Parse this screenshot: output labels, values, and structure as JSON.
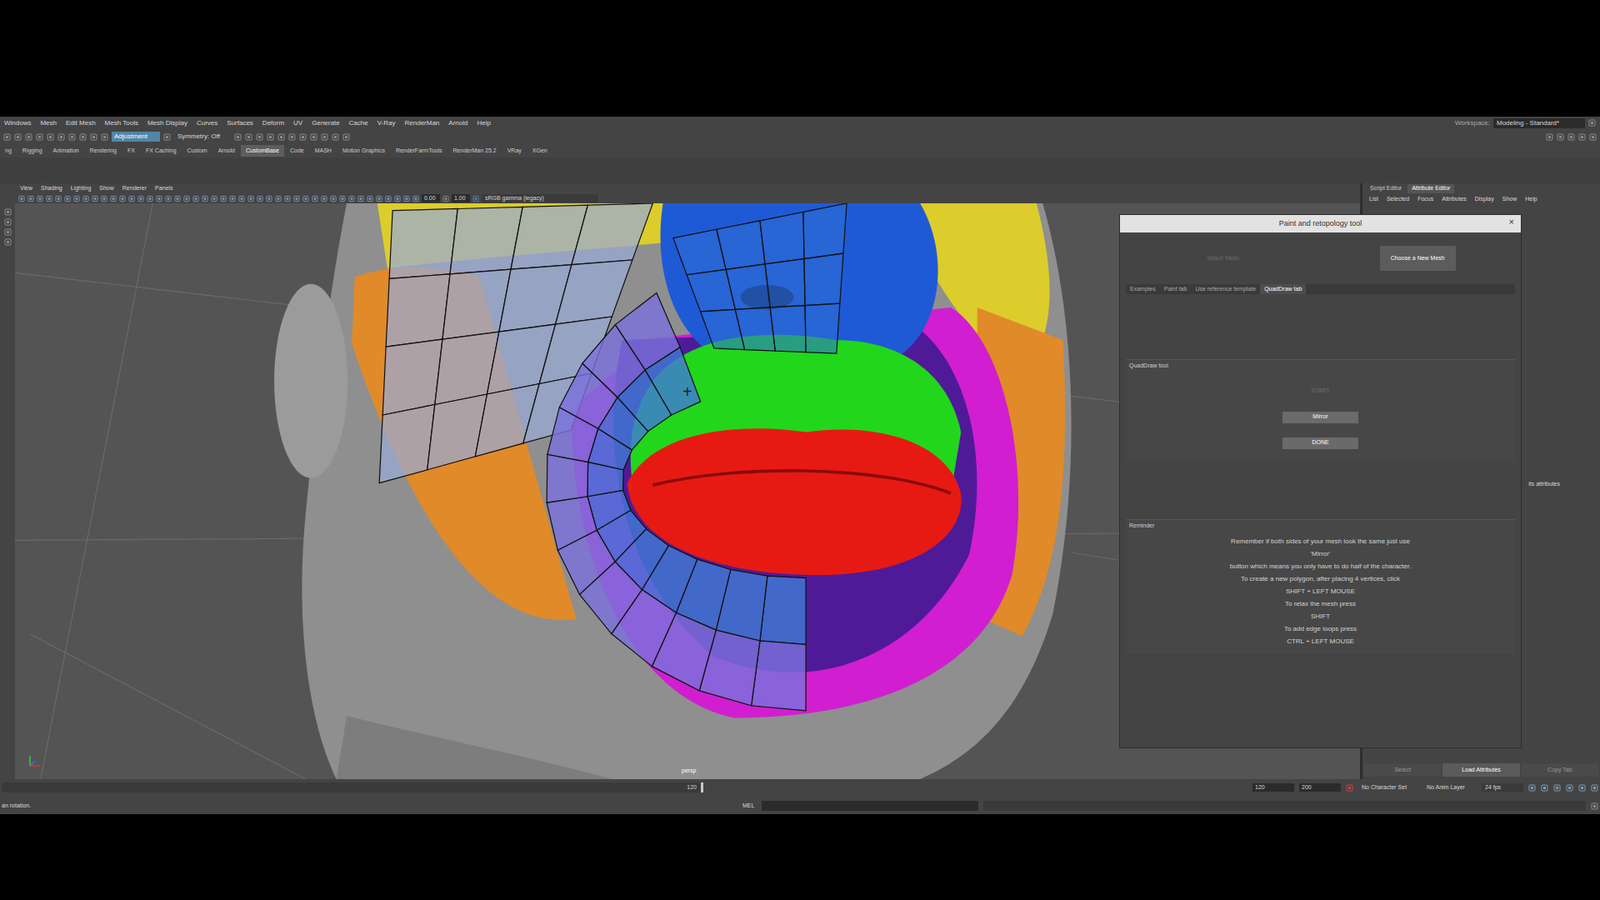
{
  "menu_bar": {
    "items": [
      "Windows",
      "Mesh",
      "Edit Mesh",
      "Mesh Tools",
      "Mesh Display",
      "Curves",
      "Surfaces",
      "Deform",
      "UV",
      "Generate",
      "Cache",
      "V-Ray",
      "RenderMan",
      "Arnold",
      "Help"
    ],
    "workspace_label": "Workspace:",
    "workspace": "Modeling - Standard*"
  },
  "status_line": {
    "mask_field": "Adjustment",
    "symmetry": "Symmetry: Off"
  },
  "shelf_tabs": [
    {
      "label": "ng",
      "selected": false
    },
    {
      "label": "Rigging",
      "selected": false
    },
    {
      "label": "Animation",
      "selected": false
    },
    {
      "label": "Rendering",
      "selected": false
    },
    {
      "label": "FX",
      "selected": false
    },
    {
      "label": "FX Caching",
      "selected": false
    },
    {
      "label": "Custom",
      "selected": false
    },
    {
      "label": "Arnold",
      "selected": false
    },
    {
      "label": "CustomBase",
      "selected": true
    },
    {
      "label": "Code",
      "selected": false
    },
    {
      "label": "MASH",
      "selected": false
    },
    {
      "label": "Motion Graphics",
      "selected": false
    },
    {
      "label": "RenderFarmTools",
      "selected": false
    },
    {
      "label": "RenderMan 25.2",
      "selected": false
    },
    {
      "label": "VRay",
      "selected": false
    },
    {
      "label": "XGen",
      "selected": false
    }
  ],
  "viewport": {
    "menu": [
      "View",
      "Shading",
      "Lighting",
      "Show",
      "Renderer",
      "Panels"
    ],
    "exposure": "0.00",
    "gamma": "1.00",
    "color_space": "sRGB gamma (legacy)",
    "camera": "persp",
    "cursor": "+",
    "paint_regions": [
      {
        "color": "#dccd2c"
      },
      {
        "color": "#e08a2a"
      },
      {
        "color": "#d11ed0"
      },
      {
        "color": "#4f1a98"
      },
      {
        "color": "#1f5ad6"
      },
      {
        "color": "#22d61c"
      },
      {
        "color": "#e61a12"
      }
    ]
  },
  "dialog": {
    "title": "Paint and retopology tool",
    "close": "×",
    "select_mesh": {
      "label": "Select Mesh",
      "disabled": true
    },
    "choose_mesh": {
      "label": "Choose a New Mesh",
      "disabled": false
    },
    "tabs": [
      {
        "label": "Examples",
        "selected": false
      },
      {
        "label": "Paint tab",
        "selected": false
      },
      {
        "label": "Use reference template",
        "selected": false
      },
      {
        "label": "QuadDraw tab",
        "selected": true
      }
    ],
    "quaddraw": {
      "title": "QuadDraw tool",
      "buttons": [
        {
          "label": "START",
          "disabled": true
        },
        {
          "label": "Mirror",
          "disabled": false
        },
        {
          "label": "DONE",
          "disabled": false
        }
      ]
    },
    "reminder": {
      "title": "Reminder",
      "lines": [
        "Remember if both sides of your mesh look the same just use",
        "'Mirror'",
        "button which means you only have to do half of the character.",
        "To create a new polygon, after placing 4 vertices, click",
        "SHIFT + LEFT MOUSE",
        "To relax the mesh press",
        "SHIFT",
        "To add edge loops press",
        "CTRL + LEFT MOUSE"
      ]
    }
  },
  "right_panel": {
    "tabs": [
      {
        "label": "Script Editor",
        "selected": false
      },
      {
        "label": "Attribute Editor",
        "selected": true
      }
    ],
    "menu": [
      "List",
      "Selected",
      "Focus",
      "Attributes",
      "Display",
      "Show",
      "Help"
    ],
    "message": "its attributes",
    "buttons": [
      {
        "label": "Select",
        "selected": false
      },
      {
        "label": "Load Attributes",
        "selected": true
      },
      {
        "label": "Copy Tab",
        "selected": false
      }
    ]
  },
  "time_slider": {
    "current": "120",
    "level": 1.0,
    "range_start": "120",
    "range_end": "200",
    "character_set": "No Character Set",
    "anim_layer": "No Anim Layer",
    "fps": "24 fps"
  },
  "command_line": {
    "language": "MEL",
    "help_line": "an rotation."
  }
}
